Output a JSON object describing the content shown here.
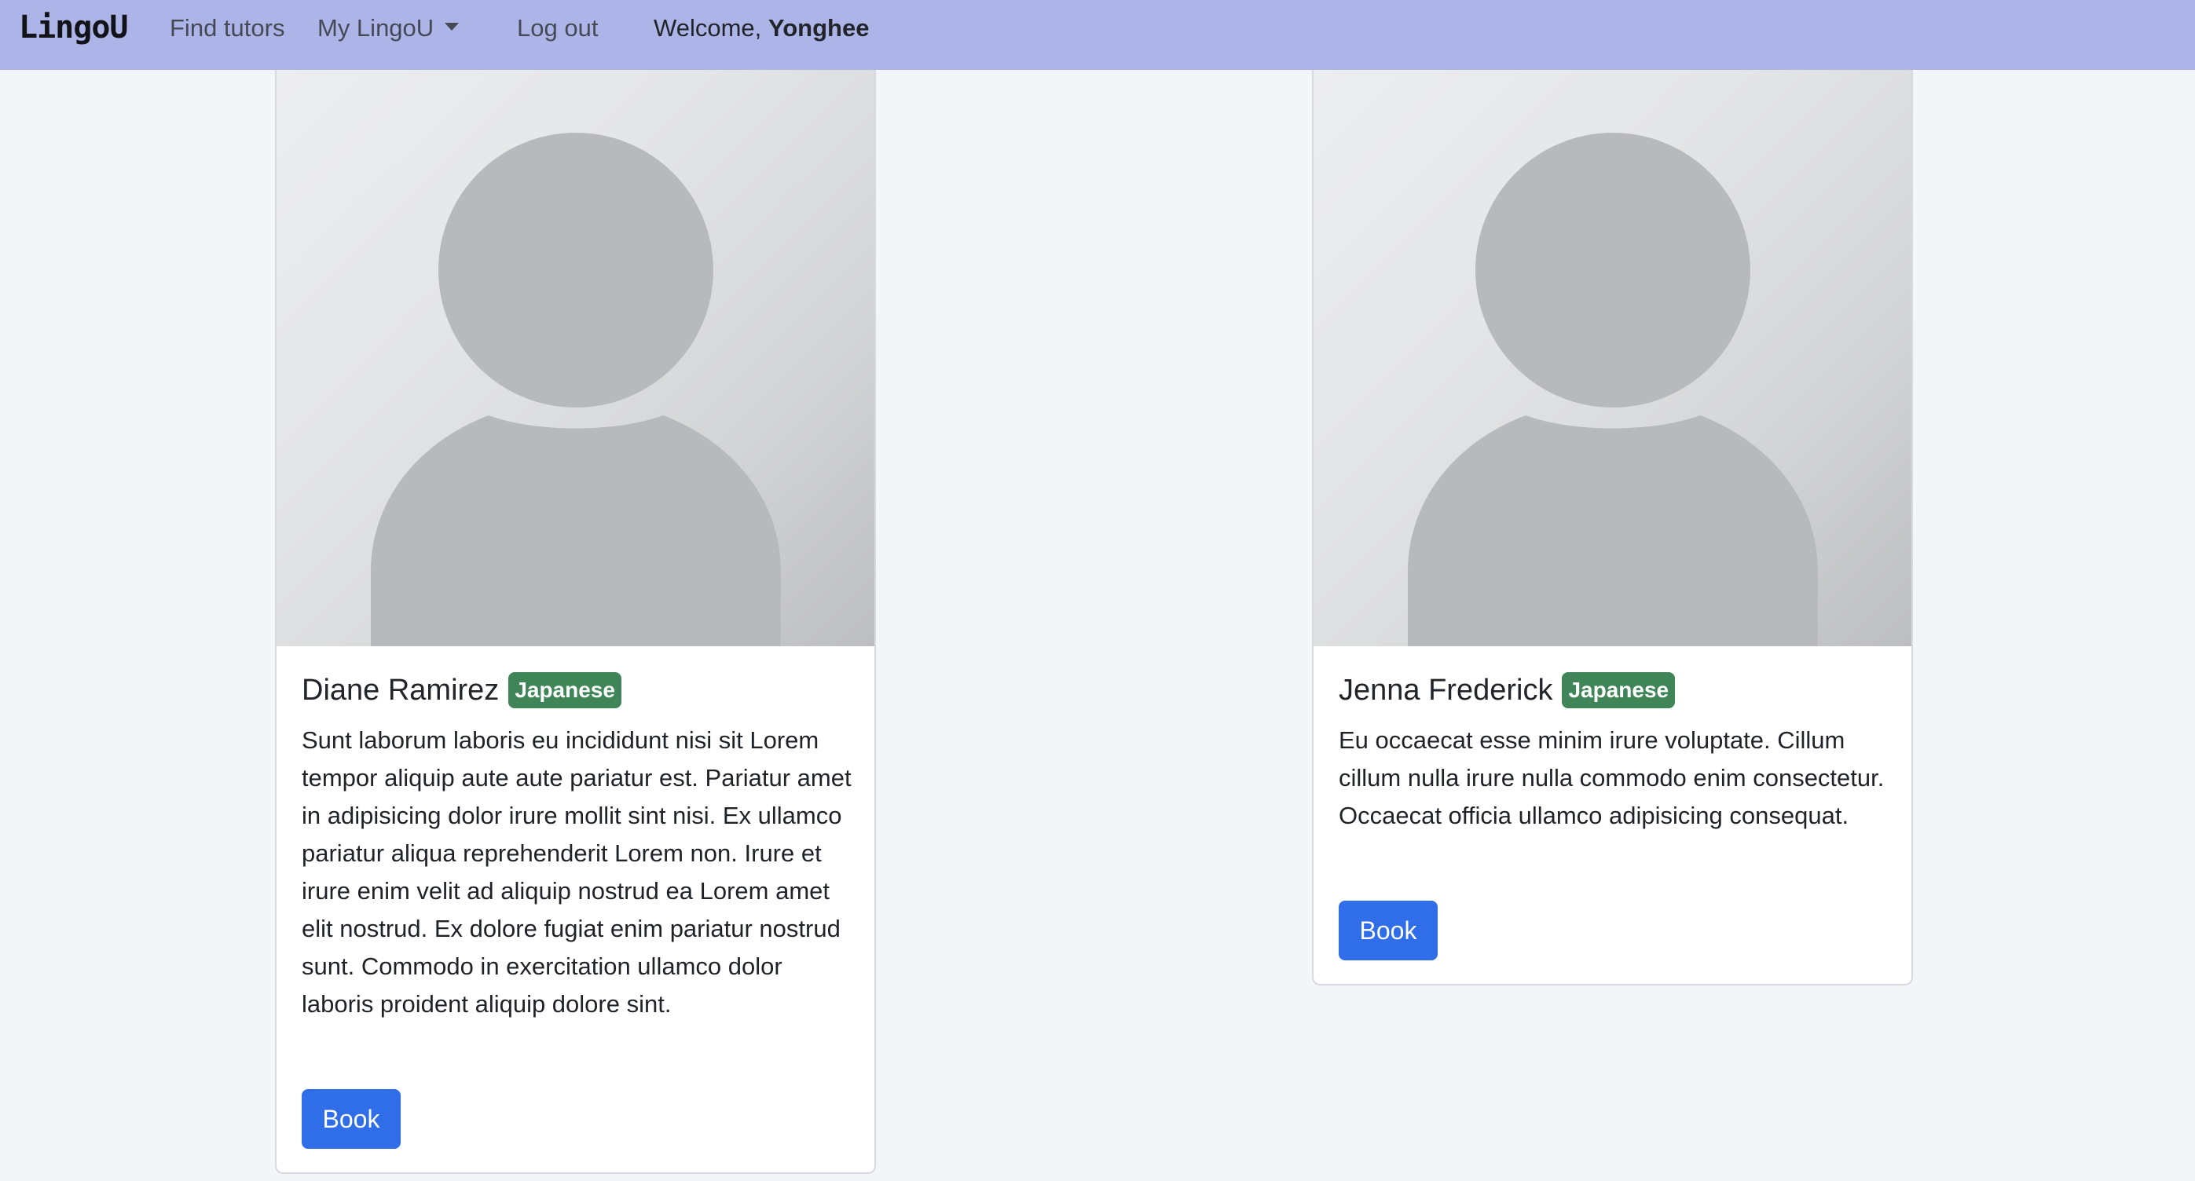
{
  "navbar": {
    "brand": "LingoU",
    "links": {
      "find_tutors": "Find tutors",
      "my_lingou": "My LingoU",
      "log_out": "Log out"
    },
    "welcome_prefix": "Welcome,",
    "username": "Yonghee"
  },
  "tutors": [
    {
      "name": "Diane Ramirez",
      "language": "Japanese",
      "bio": "Sunt laborum laboris eu incididunt nisi sit Lorem tempor aliquip aute aute pariatur est. Pariatur amet in adipisicing dolor irure mollit sint nisi. Ex ullamco pariatur aliqua reprehenderit Lorem non. Irure et irure enim velit ad aliquip nostrud ea Lorem amet elit nostrud. Ex dolore fugiat enim pariatur nostrud sunt. Commodo in exercitation ullamco dolor laboris proident aliquip dolore sint.",
      "book_label": "Book",
      "photo_icon": "avatar-placeholder-icon"
    },
    {
      "name": "Jenna Frederick",
      "language": "Japanese",
      "bio": "Eu occaecat esse minim irure voluptate. Cillum cillum nulla irure nulla commodo enim consectetur. Occaecat officia ullamco adipisicing consequat.",
      "book_label": "Book",
      "photo_icon": "avatar-placeholder-icon"
    }
  ],
  "colors": {
    "navbar_bg": "#adb5e8",
    "page_bg": "#f4f5f8",
    "badge_bg": "#3f8558",
    "button_bg": "#2f6ee8"
  }
}
